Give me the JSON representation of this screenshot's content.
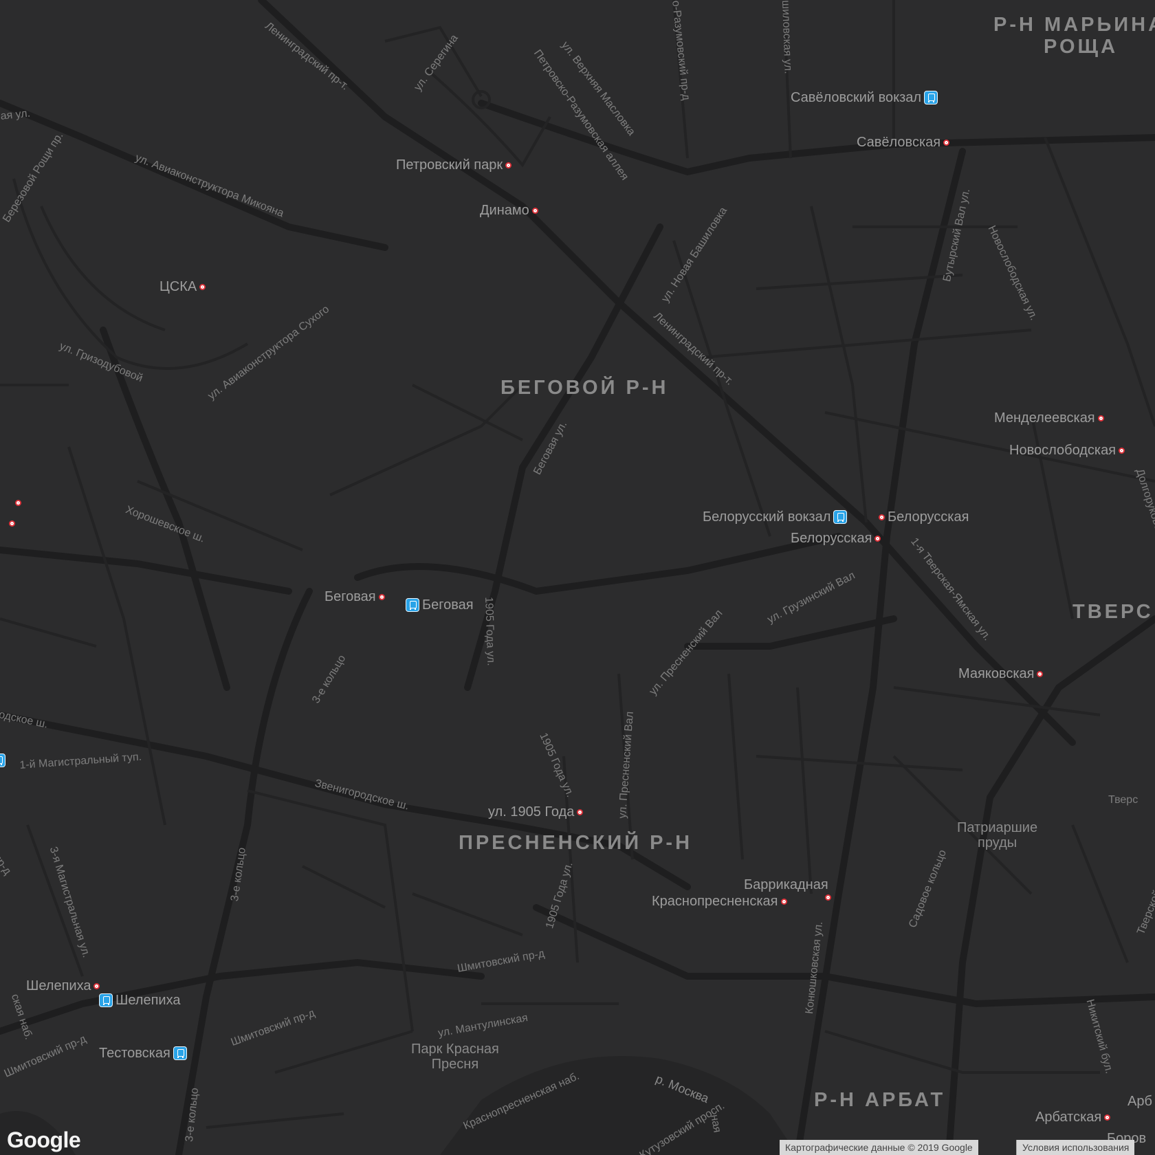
{
  "map": {
    "colors": {
      "background": "#2c2c2d",
      "road_major": "#1f1f20",
      "road_minor": "#222223",
      "water": "#232324",
      "park": "#303031",
      "metro": "#e0323a",
      "rail": "#29a3e8"
    },
    "districts": [
      "Р-Н МАРЬИНА",
      "РОЩА",
      "БЕГОВОЙ Р-Н",
      "ПРЕСНЕНСКИЙ Р-Н",
      "ТВЕРС",
      "Р-Н АРБАТ"
    ],
    "streets": [
      "Ленинградский пр-т.",
      "ул. Серегина",
      "Петровско-Разумовская аллея",
      "ул. Верхняя Масловка",
      "о-Разумовский пр-д",
      "шиловская ул.",
      "ая ул.",
      "Березовой Рощи пр.",
      "ул. Авиаконструктора Микояна",
      "ул. Новая Башиловка",
      "Ленинградский пр-т.",
      "Бутырский Вал ул.",
      "Новослободская ул.",
      "ул. Гризодубовой",
      "ул. Авиаконструктора Сухого",
      "Беговая ул.",
      "Хорошевское ш.",
      "1905 Года ул.",
      "ул. Грузинский Вал",
      "1-я Тверская-Ямская ул.",
      "Долгоруковская ул.",
      "ул. Пресненский Вал",
      "3-е кольцо",
      "одское ш.",
      "1-й Магистральный туп.",
      "Звенигородское ш.",
      "1905 Года ул.",
      "ул. Пресненский Вал",
      "3-е кольцо",
      "3-я Магистральная ул.",
      "пр-д",
      "1905 Года ул.",
      "Конюшковская ул.",
      "Садовое кольцо",
      "Тверской б-р",
      "Шмитовский пр-д",
      "Шмитовский пр-д",
      "ул. Мантулинская",
      "Шмитовский пр-д",
      "Краснопресненская наб.",
      "ская наб.",
      "3-е кольцо",
      "Кутузовский просп.",
      "Никитский бул.",
      "Тверс",
      "ная"
    ],
    "water": [
      "р. Москва"
    ],
    "parks": [
      [
        "Патриаршие",
        "пруды"
      ],
      [
        "Парк Красная",
        "Пресня"
      ]
    ],
    "stations": [
      {
        "name": "Савёловский вокзал",
        "kind": "rail"
      },
      {
        "name": "Савёловская",
        "kind": "metro"
      },
      {
        "name": "Петровский парк",
        "kind": "metro"
      },
      {
        "name": "Динамо",
        "kind": "metro"
      },
      {
        "name": "ЦСКА",
        "kind": "metro"
      },
      {
        "name": "Менделеевская",
        "kind": "metro"
      },
      {
        "name": "Новослободская",
        "kind": "metro"
      },
      {
        "name": "Белорусский вокзал",
        "kind": "rail"
      },
      {
        "name": "Белорусская",
        "kind": "metro"
      },
      {
        "name": "Белорусская",
        "kind": "metro"
      },
      {
        "name": "Беговая",
        "kind": "metro"
      },
      {
        "name": "Беговая",
        "kind": "rail"
      },
      {
        "name": "Маяковская",
        "kind": "metro"
      },
      {
        "name": "ул. 1905 Года",
        "kind": "metro"
      },
      {
        "name": "Баррикадная",
        "kind": "metro"
      },
      {
        "name": "Краснопресненская",
        "kind": "metro"
      },
      {
        "name": "Шелепиха",
        "kind": "metro"
      },
      {
        "name": "Шелепиха",
        "kind": "rail"
      },
      {
        "name": "Тестовская",
        "kind": "rail"
      },
      {
        "name": "Арбатская",
        "kind": "metro"
      },
      {
        "name": "Боров",
        "kind": "metro"
      },
      {
        "name": "Арб",
        "kind": "metro"
      }
    ],
    "logo": "Google",
    "attribution": {
      "data": "Картографические данные © 2019 Google",
      "terms": "Условия использования"
    }
  }
}
